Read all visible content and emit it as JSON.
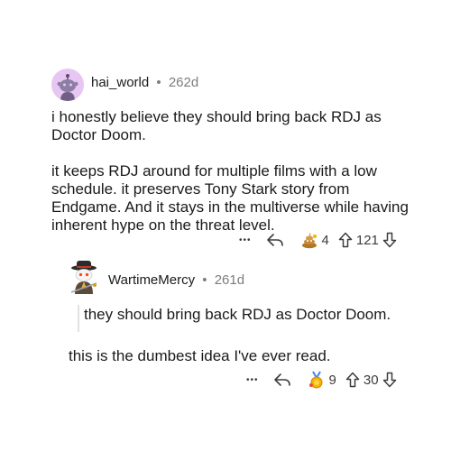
{
  "comment": {
    "username": "hai_world",
    "separator": "•",
    "age": "262d",
    "paragraphs": [
      "i honestly believe they should bring back RDJ as Doctor Doom.",
      "it keeps RDJ around for multiple films with a low schedule. it preserves Tony Stark story from Endgame. And it stays in the multiverse while having inherent hype on the threat level."
    ],
    "more_label": "•••",
    "award_count": "4",
    "vote_score": "121"
  },
  "reply": {
    "username": "WartimeMercy",
    "separator": "•",
    "age": "261d",
    "paragraphs": [
      "they should bring back RDJ as Doctor Doom.",
      "this is the dumbest idea I've ever read."
    ],
    "more_label": "•••",
    "award_count": "9",
    "vote_score": "30"
  },
  "icons": {
    "more": "more-options-icon",
    "reply": "reply-arrow-icon",
    "award_poop": "poop-award-icon",
    "award_medal": "medal-award-icon",
    "upvote": "upvote-arrow-icon",
    "downvote": "downvote-arrow-icon"
  },
  "colors": {
    "avatar_bg": "#e8c6f3",
    "meta_gray": "#7c7c7c",
    "text": "#1a1a1b"
  }
}
